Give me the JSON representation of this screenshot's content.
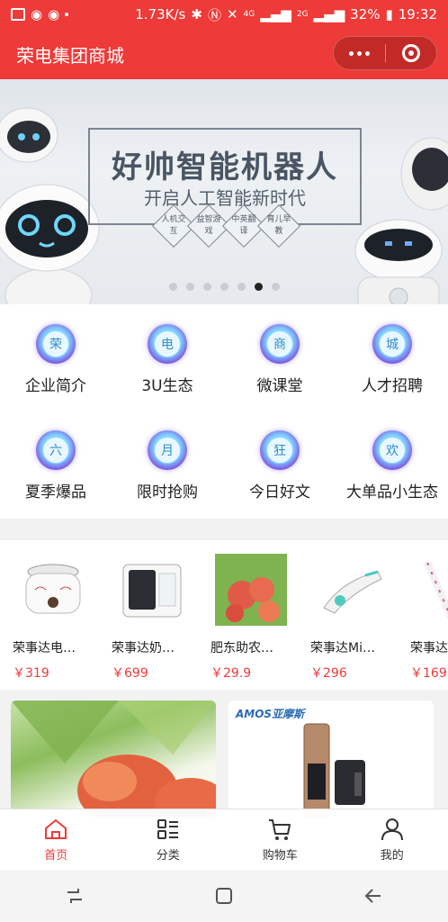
{
  "status_bar": {
    "speed": "1.73K/s",
    "battery": "32%",
    "time": "19:32",
    "net_4g": "4G",
    "net_2g": "2G"
  },
  "header": {
    "title": "荣电集团商城"
  },
  "banner": {
    "title": "好帅智能机器人",
    "subtitle": "开启人工智能新时代",
    "badges": [
      "人机交互",
      "益智游戏",
      "中英翻译",
      "育儿早教"
    ],
    "active_dot_index": 5,
    "dot_count": 7
  },
  "menu": {
    "items": [
      {
        "icon_char": "荣",
        "label": "企业简介"
      },
      {
        "icon_char": "电",
        "label": "3U生态"
      },
      {
        "icon_char": "商",
        "label": "微课堂"
      },
      {
        "icon_char": "城",
        "label": "人才招聘"
      },
      {
        "icon_char": "六",
        "label": "夏季爆品"
      },
      {
        "icon_char": "月",
        "label": "限时抢购"
      },
      {
        "icon_char": "狂",
        "label": "今日好文"
      },
      {
        "icon_char": "欢",
        "label": "大单品小生态"
      }
    ]
  },
  "products": {
    "items": [
      {
        "name": "荣事达电…",
        "price": "￥319"
      },
      {
        "name": "荣事达奶…",
        "price": "￥699"
      },
      {
        "name": "肥东助农…",
        "price": "￥29.9"
      },
      {
        "name": "荣事达Mi…",
        "price": "￥296"
      },
      {
        "name": "荣事达",
        "price": "￥169"
      }
    ]
  },
  "cards": {
    "right_brand": "AMOS亚摩斯"
  },
  "tabbar": {
    "tabs": [
      {
        "label": "首页",
        "icon": "home-icon",
        "active": true
      },
      {
        "label": "分类",
        "icon": "category-icon",
        "active": false
      },
      {
        "label": "购物车",
        "icon": "cart-icon",
        "active": false
      },
      {
        "label": "我的",
        "icon": "user-icon",
        "active": false
      }
    ]
  },
  "colors": {
    "brand_red": "#ee3a38",
    "price_red": "#ee3a38"
  }
}
